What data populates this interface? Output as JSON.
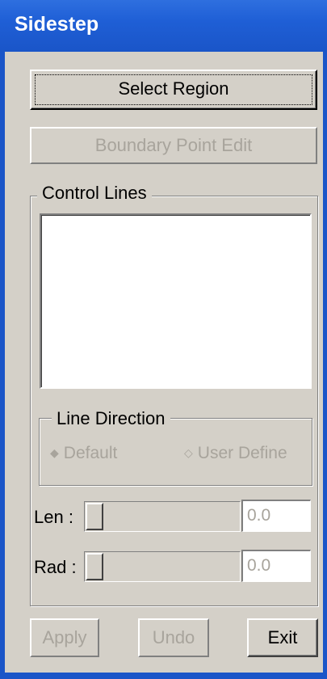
{
  "window": {
    "title": "Sidestep"
  },
  "buttons": {
    "select_region": "Select Region",
    "boundary_point_edit": "Boundary Point Edit",
    "apply": "Apply",
    "undo": "Undo",
    "exit": "Exit"
  },
  "control_lines": {
    "label": "Control Lines",
    "items": []
  },
  "line_direction": {
    "label": "Line Direction",
    "options": [
      {
        "label": "Default",
        "selected": true
      },
      {
        "label": "User Define",
        "selected": false
      }
    ]
  },
  "len": {
    "label": "Len :",
    "value": "0.0",
    "slider_fraction": 0
  },
  "rad": {
    "label": "Rad :",
    "value": "0.0",
    "slider_fraction": 0
  },
  "colors": {
    "titlebar": "#1f5fd6",
    "face": "#d4d0c8",
    "disabled_text": "#a8a49c"
  },
  "icons": {
    "radio_selected": "◆",
    "radio_unselected": "◇"
  }
}
